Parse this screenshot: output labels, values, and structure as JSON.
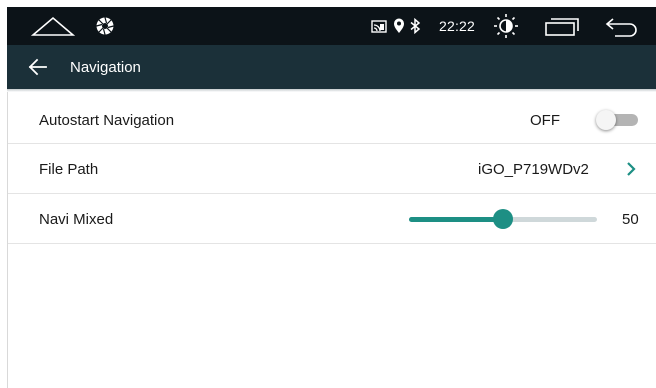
{
  "status_bar": {
    "time": "22:22",
    "icons": [
      "home-icon",
      "aperture-icon",
      "cast-icon",
      "location-icon",
      "bluetooth-icon",
      "brightness-icon",
      "window-icon",
      "back-icon"
    ]
  },
  "header": {
    "title": "Navigation",
    "back_icon": "arrow-left-icon"
  },
  "settings": {
    "autostart": {
      "label": "Autostart Navigation",
      "value": "OFF",
      "enabled": false
    },
    "file_path": {
      "label": "File Path",
      "value": "iGO_P719WDv2"
    },
    "navi_mixed": {
      "label": "Navi Mixed",
      "value": "50",
      "level_percent": 50
    }
  },
  "colors": {
    "status_bar_bg": "#0c1318",
    "header_bg": "#1b3039",
    "accent": "#1d8f84",
    "toggle_off": "#b4b4b4"
  }
}
